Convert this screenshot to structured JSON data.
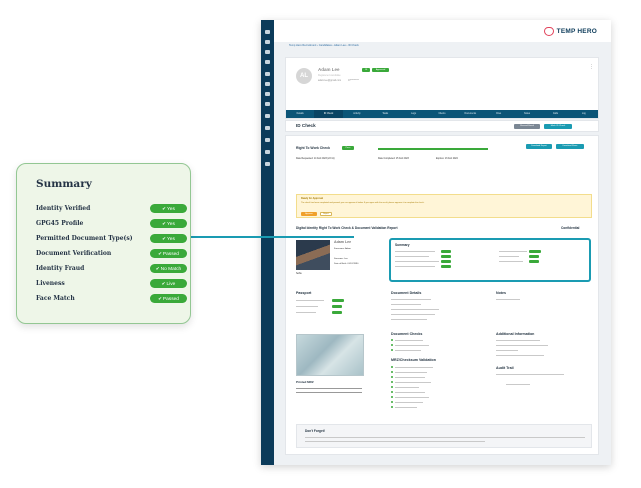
{
  "summary": {
    "title": "Summary",
    "rows": [
      {
        "label": "Identity Verified",
        "status": "Yes"
      },
      {
        "label": "GPG45 Profile",
        "status": "Yes"
      },
      {
        "label": "Permitted Document Type(s)",
        "status": "Yes"
      },
      {
        "label": "Document Verification",
        "status": "Passed"
      },
      {
        "label": "Identity Fraud",
        "status": "No Match"
      },
      {
        "label": "Liveness",
        "status": "Live"
      },
      {
        "label": "Face Match",
        "status": "Passed"
      }
    ],
    "check_icon": "check-circle-icon"
  },
  "app": {
    "brand": "TEMP HERO",
    "breadcrumb": "Temp Hero Recruitment  ›  Candidates  ›  Adam Lee  ›  ID Check",
    "profile": {
      "avatar_initials": "AL",
      "name": "Adam Lee",
      "subtitle": "Registered candidate",
      "email": "adam.lee@gmail.com",
      "phone": "07*********",
      "tags": [
        "16",
        "Approved"
      ]
    },
    "tabs": [
      "Details",
      "ID Check",
      "Activity",
      "Tasks",
      "Logs",
      "Clients",
      "Documents",
      "Files",
      "Notes",
      "Calls",
      "Log"
    ],
    "id_check": {
      "title": "ID Check",
      "actions": [
        "Resend Email",
        "Mark ID Check"
      ]
    },
    "right_to_work": {
      "title": "Right To Work Check",
      "status": "Pass",
      "date_requested": "Date Requested: 14 Feb 2023 (22:11)",
      "date_completed": "Date Completed: 15 Feb 2023",
      "expires": "Expires: 16 Feb 2024",
      "buttons": [
        "Download Report",
        "Download Share"
      ]
    },
    "notice": {
      "title": "Ready for Approval",
      "text": "The check has been completed and passed, you can approve it below. If you agree with the result, please approve it to complete the check.",
      "buttons": [
        "Approve",
        "Reject"
      ]
    },
    "report": {
      "title": "Digital Identity Right To Work Check & Document Validation Report",
      "classification": "Confidential",
      "candidate_name": "Adam Lee",
      "photo_label": "Selfie",
      "fields": [
        "Forename: Adam",
        "Surname: Lee",
        "Date of Birth: 01/01/1990"
      ]
    },
    "sections": {
      "passport": "Passport",
      "document_details": "Document Details",
      "notes": "Notes",
      "document_checks": "Document Checks",
      "mrz_validation": "MRZ/Checksum Validation",
      "additional_information": "Additional Information",
      "audit_trail": "Audit Trail",
      "printed_mrz": "Printed MRZ",
      "dont_forget": "Don't Forget!"
    }
  },
  "colors": {
    "green": "#3aa93a",
    "teal": "#1a9bb2",
    "navy": "#0c3b5a",
    "card_bg": "#eef6e8"
  }
}
